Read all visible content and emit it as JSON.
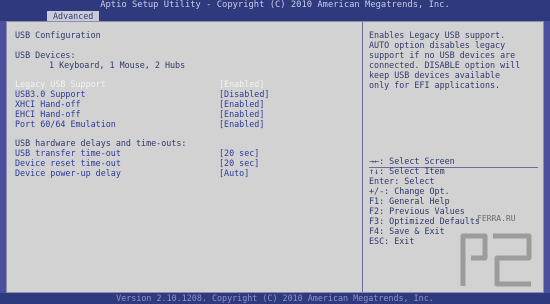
{
  "header": {
    "title": "Aptio Setup Utility - Copyright (C) 2010 American Megatrends, Inc.",
    "tab": "Advanced"
  },
  "left": {
    "section_title": "USB Configuration",
    "devices_label": "USB Devices:",
    "devices_value": "1 Keyboard, 1 Mouse, 2 Hubs",
    "options": [
      {
        "label": "Legacy USB Support",
        "value": "[Enabled]"
      },
      {
        "label": "USB3.0 Support",
        "value": "[Disabled]"
      },
      {
        "label": "XHCI Hand-off",
        "value": "[Enabled]"
      },
      {
        "label": "EHCI Hand-off",
        "value": "[Enabled]"
      },
      {
        "label": "Port 60/64 Emulation",
        "value": "[Enabled]"
      }
    ],
    "delays_title": "USB hardware delays and time-outs:",
    "delays": [
      {
        "label": "USB transfer time-out",
        "value": "[20 sec]"
      },
      {
        "label": "Device reset time-out",
        "value": "[20 sec]"
      },
      {
        "label": "Device power-up delay",
        "value": "[Auto]"
      }
    ]
  },
  "help": {
    "lines": [
      "Enables Legacy USB support.",
      "AUTO option disables legacy",
      "support if no USB devices are",
      "connected. DISABLE option will",
      "keep USB devices available",
      "only for EFI applications."
    ]
  },
  "keys": {
    "lines": [
      "→←: Select Screen",
      "↑↓: Select Item",
      "Enter: Select",
      "+/-: Change Opt.",
      "F1: General Help",
      "F2: Previous Values",
      "F3: Optimized Defaults",
      "F4: Save & Exit",
      "ESC: Exit"
    ]
  },
  "watermark": {
    "text": "FERRA.RU",
    "logo": "ferra-logo"
  },
  "footer": {
    "text": "Version 2.10.1208. Copyright (C) 2010 American Megatrends, Inc."
  },
  "colors": {
    "background": "#4a4f9e",
    "panel": "#d2d2d2",
    "bar": "#2f3a7e",
    "highlight": "#f2f2f2"
  }
}
